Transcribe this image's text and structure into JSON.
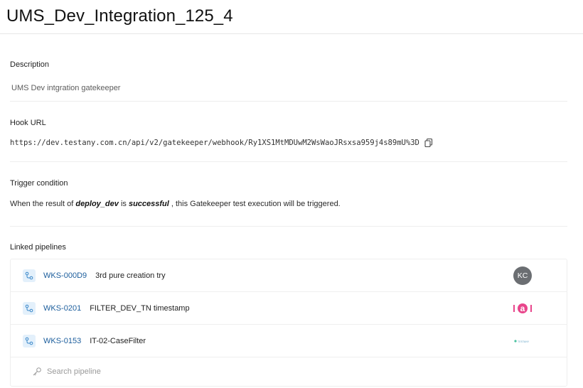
{
  "page": {
    "title": "UMS_Dev_Integration_125_4"
  },
  "description": {
    "label": "Description",
    "value": "UMS Dev intgration gatekeeper"
  },
  "hook": {
    "label": "Hook URL",
    "url": "https://dev.testany.com.cn/api/v2/gatekeeper/webhook/Ry1XS1MtMDUwM2WsWaoJRsxsa959j4s89mU%3D",
    "copy_icon": "copy-icon"
  },
  "trigger": {
    "label": "Trigger condition",
    "prefix": "When the result of",
    "pipeline": "deploy_dev",
    "middle": "is",
    "status": "successful",
    "suffix": ", this Gatekeeper test execution will be triggered."
  },
  "linked": {
    "label": "Linked pipelines",
    "pipelines": [
      {
        "id": "WKS-000D9",
        "name": "3rd pure creation try",
        "avatar": "KC"
      },
      {
        "id": "WKS-0201",
        "name": "FILTER_DEV_TN timestamp",
        "avatar": "a"
      },
      {
        "id": "WKS-0153",
        "name": "IT-02-CaseFilter",
        "avatar": "TESTANY"
      }
    ],
    "search_placeholder": "Search pipeline"
  },
  "colors": {
    "link": "#1b5d9c",
    "avatar_kc": "#6b6e72",
    "avatar_a": "#e8458b",
    "pipeline_icon_bg": "#e3f0fb"
  }
}
